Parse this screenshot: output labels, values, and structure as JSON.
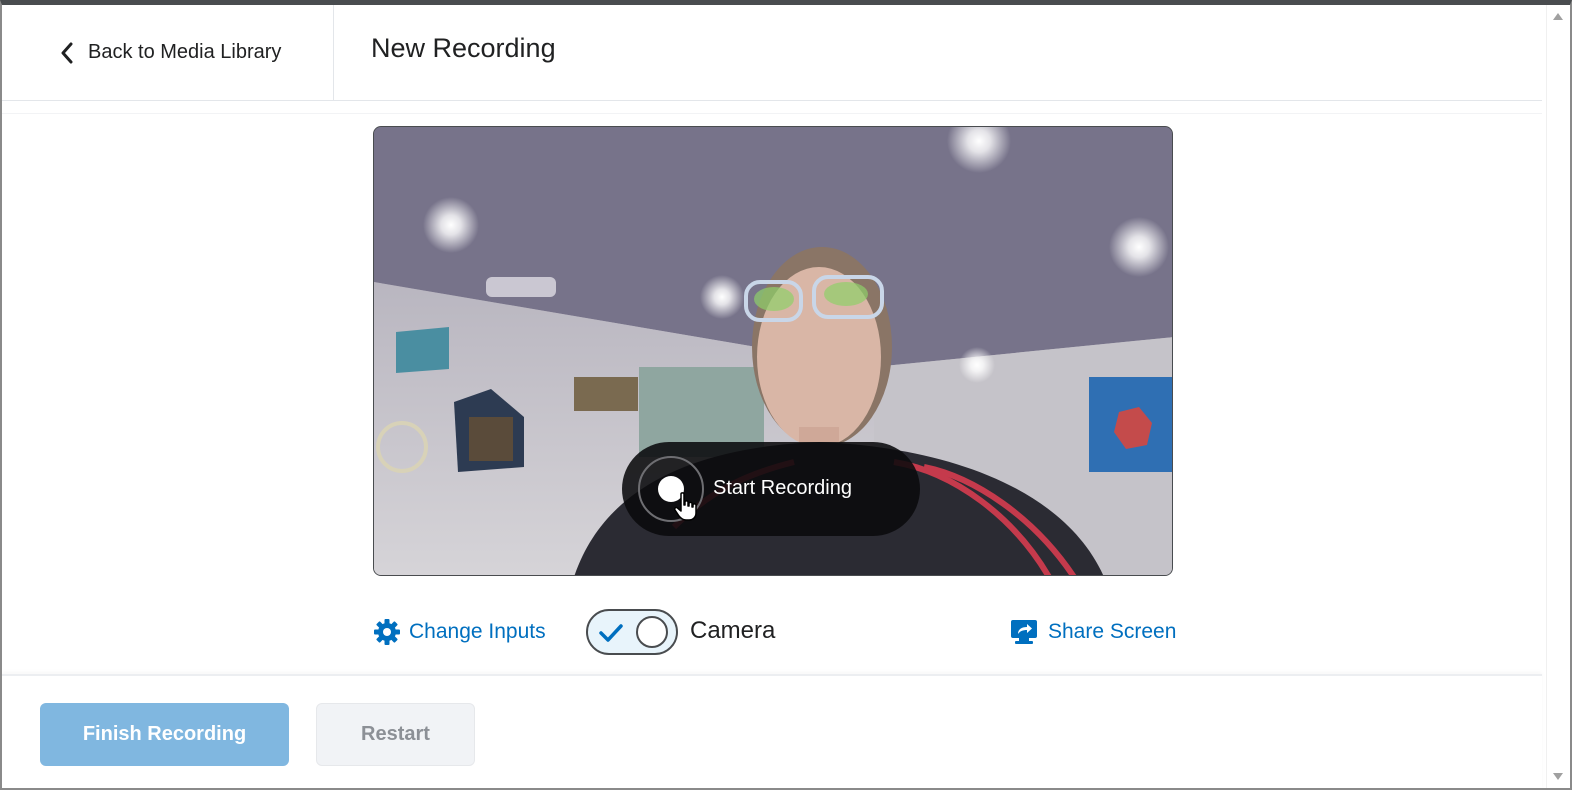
{
  "header": {
    "back_label": "Back to Media Library",
    "title": "New Recording"
  },
  "video": {
    "record_label": "Start Recording"
  },
  "controls": {
    "change_inputs_label": "Change Inputs",
    "camera_label": "Camera",
    "camera_enabled": true,
    "share_screen_label": "Share Screen"
  },
  "footer": {
    "finish_label": "Finish Recording",
    "restart_label": "Restart"
  },
  "colors": {
    "link": "#006fbf",
    "primary_disabled": "#80b7e0",
    "secondary_disabled": "#f1f3f6"
  },
  "icons": [
    "chevron-left-icon",
    "record-icon",
    "hand-cursor-icon",
    "gear-icon",
    "check-icon",
    "share-screen-icon"
  ]
}
